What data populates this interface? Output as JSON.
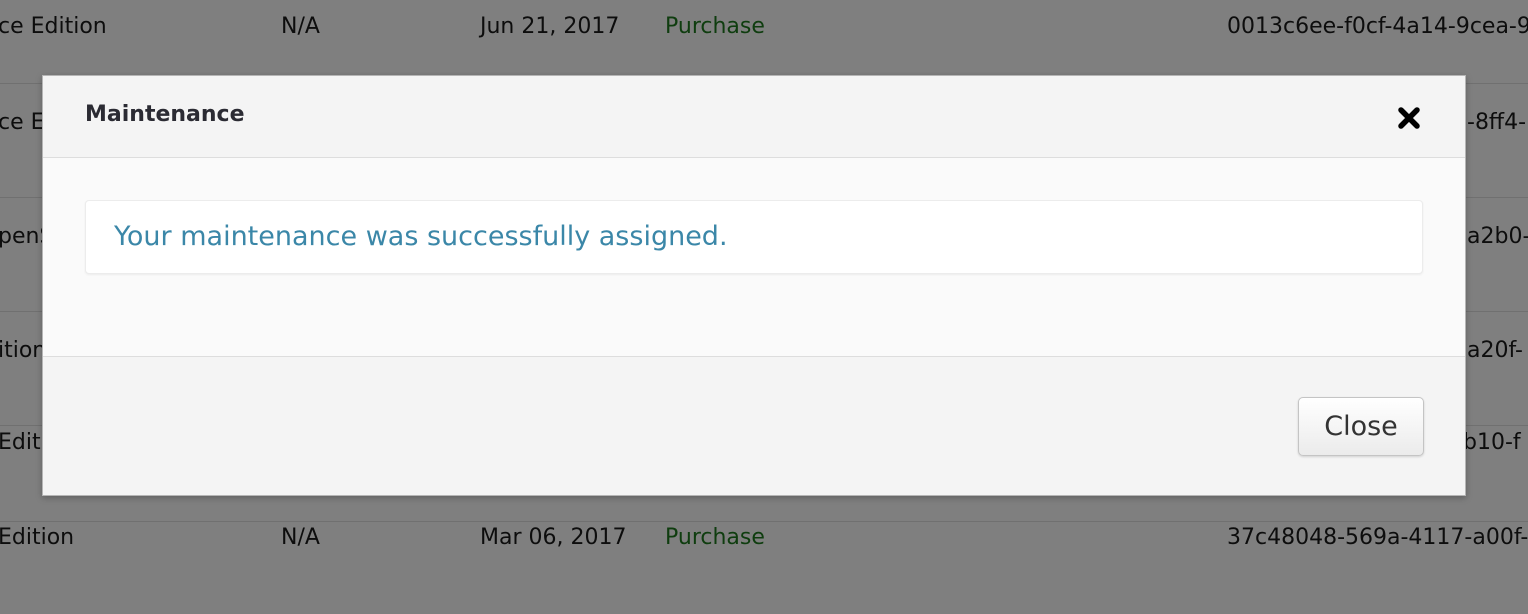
{
  "background_table": {
    "rows": [
      {
        "product": "ce Edition",
        "expires": "N/A",
        "date": "Jun 21, 2017",
        "type": "Purchase",
        "uuid": "0013c6ee-f0cf-4a14-9cea-9"
      },
      {
        "product": "ce Ec",
        "expires": "",
        "date": "",
        "type": "",
        "uuid": "-8ff4-"
      },
      {
        "product": "penS",
        "expires": "",
        "date": "",
        "type": "",
        "uuid": "a2b0-"
      },
      {
        "product": "ition",
        "expires": "",
        "date": "",
        "type": "",
        "uuid": "a20f-"
      },
      {
        "product": "Editi",
        "expires": "",
        "date": "",
        "type": "",
        "uuid": "b10-f"
      },
      {
        "product": "Edition",
        "expires": "N/A",
        "date": "Mar 06, 2017",
        "type": "Purchase",
        "uuid": "37c48048-569a-4117-a00f-"
      }
    ]
  },
  "modal": {
    "title": "Maintenance",
    "close_icon": "close-x-icon",
    "message": "Your maintenance was successfully assigned.",
    "close_button_label": "Close"
  },
  "colors": {
    "overlay": "rgba(0,0,0,0.5)",
    "message": "#3b87a8",
    "purchase": "#1e7a1e",
    "title": "#2b2b33"
  }
}
